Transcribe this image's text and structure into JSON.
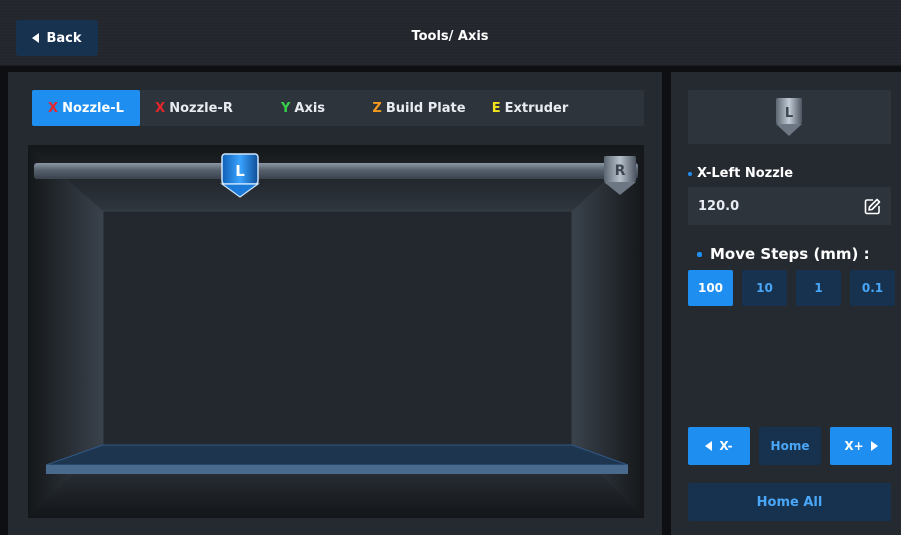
{
  "header": {
    "back_label": "Back",
    "title": "Tools/ Axis"
  },
  "tabs": [
    {
      "axis": "X",
      "label": "Nozzle-L",
      "axis_color": "#e8262b",
      "active": true
    },
    {
      "axis": "X",
      "label": "Nozzle-R",
      "axis_color": "#e8262b",
      "active": false
    },
    {
      "axis": "Y",
      "label": "Axis",
      "axis_color": "#37d04a",
      "active": false
    },
    {
      "axis": "Z",
      "label": "Build Plate",
      "axis_color": "#f39a1e",
      "active": false
    },
    {
      "axis": "E",
      "label": "Extruder",
      "axis_color": "#f2e21c",
      "active": false
    }
  ],
  "scene": {
    "nozzle_left_letter": "L",
    "nozzle_right_letter": "R"
  },
  "side": {
    "preview_letter": "L",
    "field_label": "X-Left Nozzle",
    "field_value": "120.0",
    "steps_title": "Move Steps (mm) :",
    "steps": [
      "100",
      "10",
      "1",
      "0.1"
    ],
    "active_step": "100",
    "jog_minus": "X-",
    "jog_home": "Home",
    "jog_plus": "X+",
    "home_all": "Home All"
  },
  "colors": {
    "accent": "#1f8ef1",
    "button_dark": "#16324f",
    "panel": "#252a30"
  }
}
